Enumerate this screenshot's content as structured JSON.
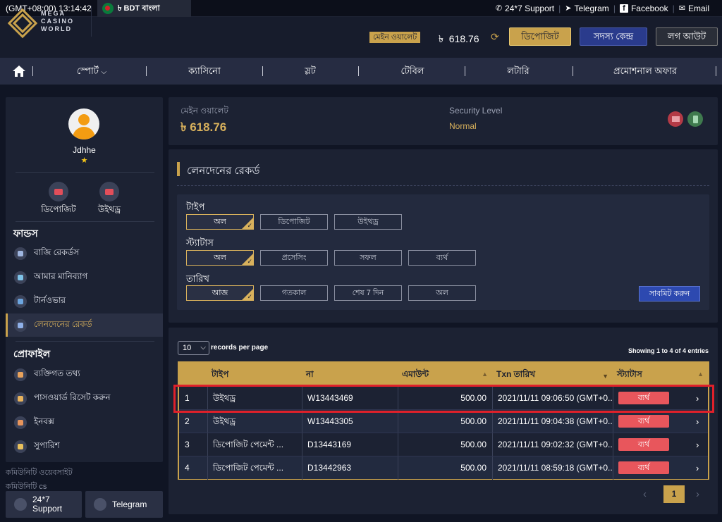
{
  "topbar": {
    "clock": "(GMT+08:00) 13:14:42",
    "lang": "৳ BDT বাংলা",
    "links": [
      "24*7 Support",
      "Telegram",
      "Facebook",
      "Email"
    ]
  },
  "header": {
    "logo": [
      "MEGA",
      "CASINO",
      "WORLD"
    ],
    "wallet_tag": "মেইন ওয়ালেট",
    "currency": "৳",
    "amount": "618.76",
    "deposit": "ডিপোজিট",
    "member_center": "সদস্য কেন্দ্র",
    "logout": "লগ আউট"
  },
  "nav": {
    "sports": "স্পোর্ট",
    "items": [
      "ক্যাসিনো",
      "স্লট",
      "টেবিল",
      "লটারি",
      "প্রমোশনাল অফার"
    ]
  },
  "sidebar": {
    "username": "Jdhhe",
    "star": "★",
    "quick": [
      "ডিপোজিট",
      "উইথড্র"
    ],
    "funds_title": "ফান্ডস",
    "funds": [
      "বাজি রেকর্ডস",
      "আমার মানিব্যাগ",
      "টার্নওভার",
      "লেনদেনের রেকর্ড"
    ],
    "profile_title": "প্রোফাইল",
    "profile": [
      "ব্যক্তিগত তথ্য",
      "পাসওয়ার্ড রিসেট করুন",
      "ইনবক্স",
      "সুপারিশ"
    ],
    "community_site": "কমিউনিটি ওয়েবসাইট",
    "community_cs": "কমিউনিটি cs",
    "support_line1": "24*7",
    "support_line2": "Support",
    "telegram": "Telegram"
  },
  "wallet": {
    "label": "মেইন ওয়ালেট",
    "amount": "৳ 618.76",
    "security_label": "Security Level",
    "security_value": "Normal"
  },
  "transactions": {
    "title": "লেনদেনের রেকর্ড",
    "type_label": "টাইপ",
    "type_opts": [
      "অল",
      "ডিপোজিট",
      "উইথড্র"
    ],
    "status_label": "স্ট্যাটাস",
    "status_opts": [
      "অল",
      "প্রসেসিং",
      "সফল",
      "ব্যর্থ"
    ],
    "date_label": "তারিখ",
    "date_opts": [
      "আজ",
      "গতকাল",
      "শেষ 7 দিন",
      "অল"
    ],
    "submit": "সাবমিট করুন"
  },
  "records": {
    "page_size": "10",
    "per_page_label": "records per page",
    "showing": "Showing 1 to 4 of 4 entries",
    "headers": [
      "টাইপ",
      "না",
      "এমাউন্ট",
      "Txn তারিখ",
      "স্ট্যাটাস"
    ],
    "rows": [
      {
        "n": "1",
        "type": "উইথড্র",
        "id": "W13443469",
        "amount": "500.00",
        "date": "2021/11/11 09:06:50 (GMT+0...",
        "status": "ব্যর্থ"
      },
      {
        "n": "2",
        "type": "উইথড্র",
        "id": "W13443305",
        "amount": "500.00",
        "date": "2021/11/11 09:04:38 (GMT+0...",
        "status": "ব্যর্থ"
      },
      {
        "n": "3",
        "type": "ডিপোজিট পেমেন্ট ...",
        "id": "D13443169",
        "amount": "500.00",
        "date": "2021/11/11 09:02:32 (GMT+0...",
        "status": "ব্যর্থ"
      },
      {
        "n": "4",
        "type": "ডিপোজিট পেমেন্ট ...",
        "id": "D13442963",
        "amount": "500.00",
        "date": "2021/11/11 08:59:18 (GMT+0...",
        "status": "ব্যর্থ"
      }
    ],
    "page": "1"
  },
  "colors": {
    "accent": "#c9a24c",
    "fail": "#e8565c",
    "highlight": "#e0202a"
  }
}
